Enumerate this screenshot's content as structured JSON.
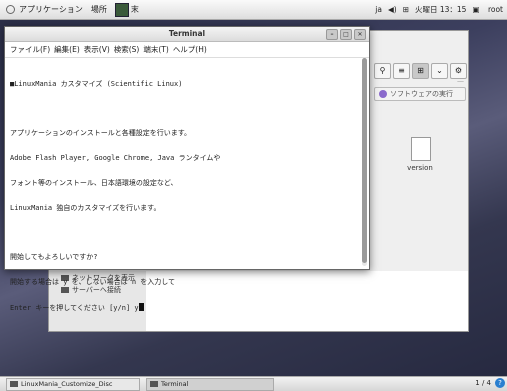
{
  "top_panel": {
    "menu_applications": "アプリケーション",
    "menu_places": "場所",
    "launcher_text": "末",
    "lang": "ja",
    "datetime": "火曜日 13：15",
    "user": "root"
  },
  "background_window": {
    "sidebar_network": "ネットワークを表示",
    "sidebar_server": "サーバーへ接続",
    "run_software_button": "ソフトウェアの実行",
    "file_label": "version"
  },
  "terminal": {
    "title": "Terminal",
    "menu": [
      "ファイル(F)",
      "編集(E)",
      "表示(V)",
      "検索(S)",
      "端末(T)",
      "ヘルプ(H)"
    ],
    "lines": [
      "■LinuxMania カスタマイズ (Scientific Linux)",
      "",
      "アプリケーションのインストールと各種設定を行います。",
      "Adobe Flash Player, Google Chrome, Java ランタイムや",
      "フォント等のインストール、日本語環境の設定など、",
      "LinuxMania 独自のカスタマイズを行います。",
      "",
      "開始してもよろしいですか?",
      "開始する場合は y を、しない場合は n を入力して",
      "Enter キーを押してください [y/n] y"
    ]
  },
  "taskbar": {
    "task1": "LinuxMania_Customize_Disc",
    "task2": "Terminal",
    "pager": "1 / 4"
  }
}
